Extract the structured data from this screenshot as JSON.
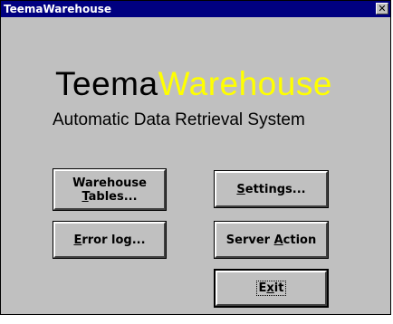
{
  "window": {
    "title": "TeemaWarehouse"
  },
  "brand": {
    "part1": "Teema",
    "part2": "Warehouse",
    "subtitle": "Automatic Data Retrieval System"
  },
  "buttons": {
    "warehouse_tables_line1": "Warehouse",
    "warehouse_tables_line2_ul": "T",
    "warehouse_tables_line2_rest": "ables...",
    "settings_ul": "S",
    "settings_rest": "ettings...",
    "error_log_ul": "E",
    "error_log_rest": "rror log...",
    "server_action_pre": "Server ",
    "server_action_ul": "A",
    "server_action_rest": "ction",
    "exit_pre": "E",
    "exit_ul": "x",
    "exit_rest": "it"
  },
  "icons": {
    "close": "close-icon"
  },
  "colors": {
    "titlebar": "#000080",
    "brand_yellow": "#ffff00",
    "face": "#c0c0c0"
  }
}
